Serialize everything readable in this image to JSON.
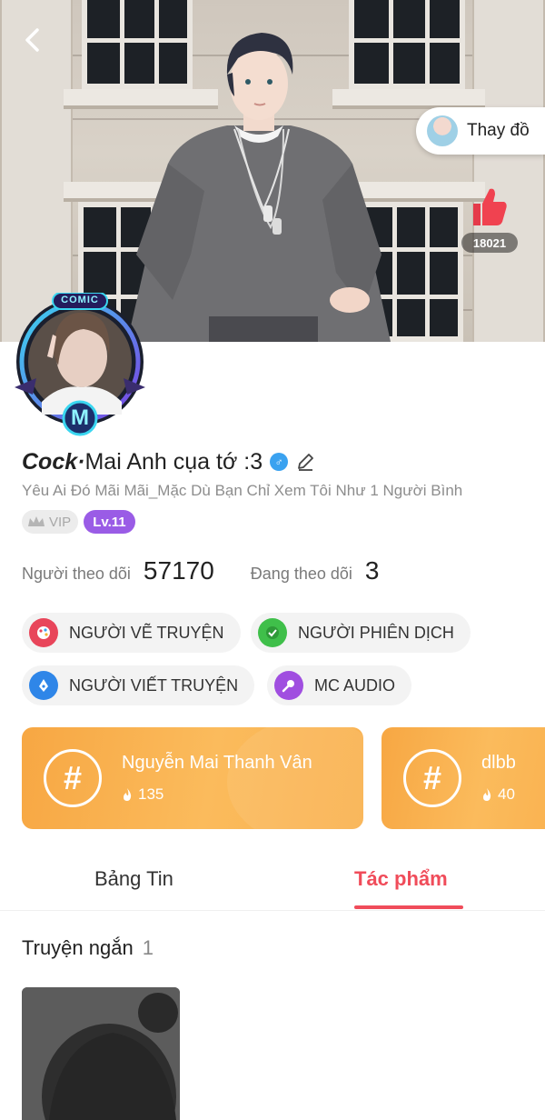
{
  "header": {
    "outfit_button_label": "Thay đồ",
    "like_count": "18021"
  },
  "avatar": {
    "frame_badge_text": "COMIC",
    "frame_letter": "M"
  },
  "profile": {
    "name_prefix": "Cock·",
    "name_rest": " Mai Anh cụa tớ :3",
    "gender_symbol": "♂",
    "bio": "Yêu Ai Đó Mãi Mãi_Mặc Dù Bạn Chỉ Xem Tôi Như 1 Người Bình",
    "vip_label": "VIP",
    "level_label": "Lv.11"
  },
  "stats": {
    "followers_label": "Người theo dõi",
    "followers_value": "57170",
    "following_label": "Đang theo dõi",
    "following_value": "3"
  },
  "roles": [
    {
      "label": "NGƯỜI VẼ TRUYỆN",
      "icon": "palette-icon",
      "color": "#e8455a"
    },
    {
      "label": "NGƯỜI PHIÊN DỊCH",
      "icon": "translate-icon",
      "color": "#3fbf4a"
    },
    {
      "label": "NGƯỜI VIẾT TRUYỆN",
      "icon": "pen-nib-icon",
      "color": "#2f86e8"
    },
    {
      "label": "MC AUDIO",
      "icon": "microphone-icon",
      "color": "#a04ee0"
    }
  ],
  "groups": [
    {
      "name": "Nguyễn Mai Thanh Vân",
      "count": "135"
    },
    {
      "name": "dlbb",
      "count": "40"
    }
  ],
  "tabs": {
    "news": "Bảng Tin",
    "works": "Tác phẩm"
  },
  "works": {
    "section_label": "Truyện ngắn",
    "section_count": "1"
  },
  "colors": {
    "accent": "#f04c5a",
    "group_card": "#f7a743",
    "level_badge": "#9a5ce6"
  }
}
